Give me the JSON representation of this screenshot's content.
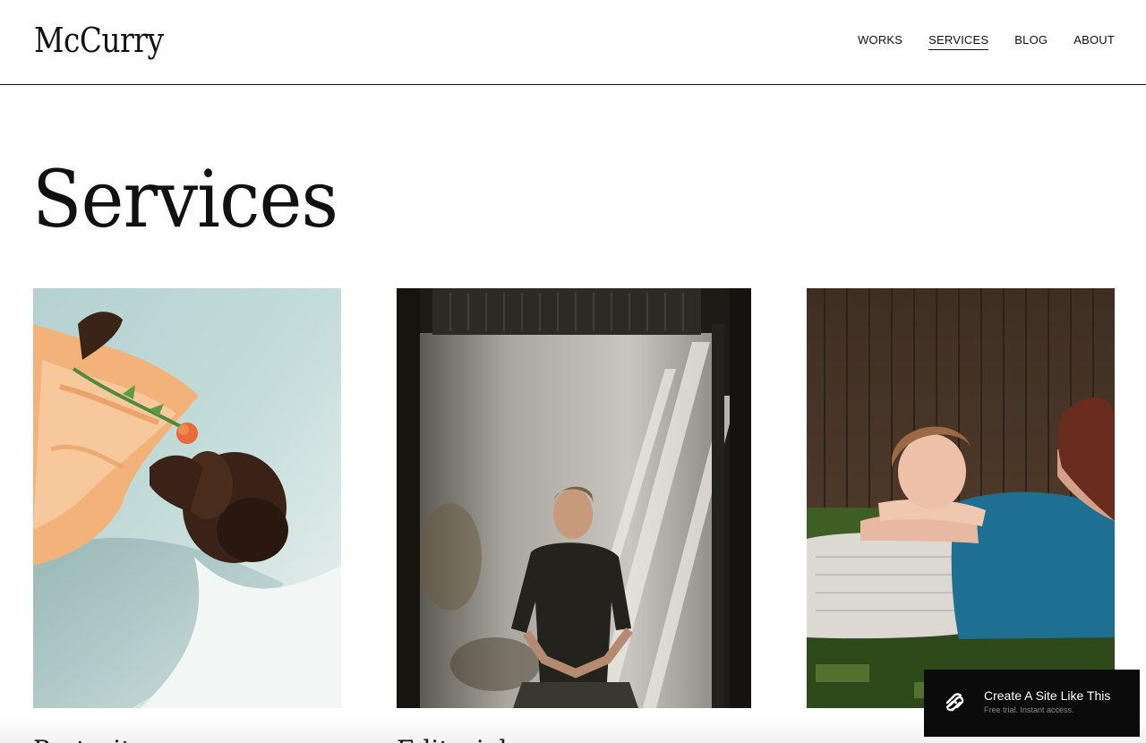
{
  "header": {
    "logo": "McCurry",
    "nav": [
      {
        "label": "WORKS",
        "active": false
      },
      {
        "label": "SERVICES",
        "active": true
      },
      {
        "label": "BLOG",
        "active": false
      },
      {
        "label": "ABOUT",
        "active": false
      }
    ]
  },
  "main": {
    "title": "Services",
    "images": [
      {
        "description_icon": "photo-woman-flower"
      },
      {
        "description_icon": "photo-man-wall"
      },
      {
        "description_icon": "photo-woman-lying"
      }
    ],
    "card_headings": [
      "Portraits",
      "Editorial"
    ]
  },
  "promo": {
    "title": "Create A Site Like This",
    "subtitle": "Free trial. Instant access.",
    "icon": "squarespace-logo-icon",
    "background": "#0b0b0b"
  },
  "colors": {
    "text": "#111111",
    "background": "#ffffff"
  }
}
